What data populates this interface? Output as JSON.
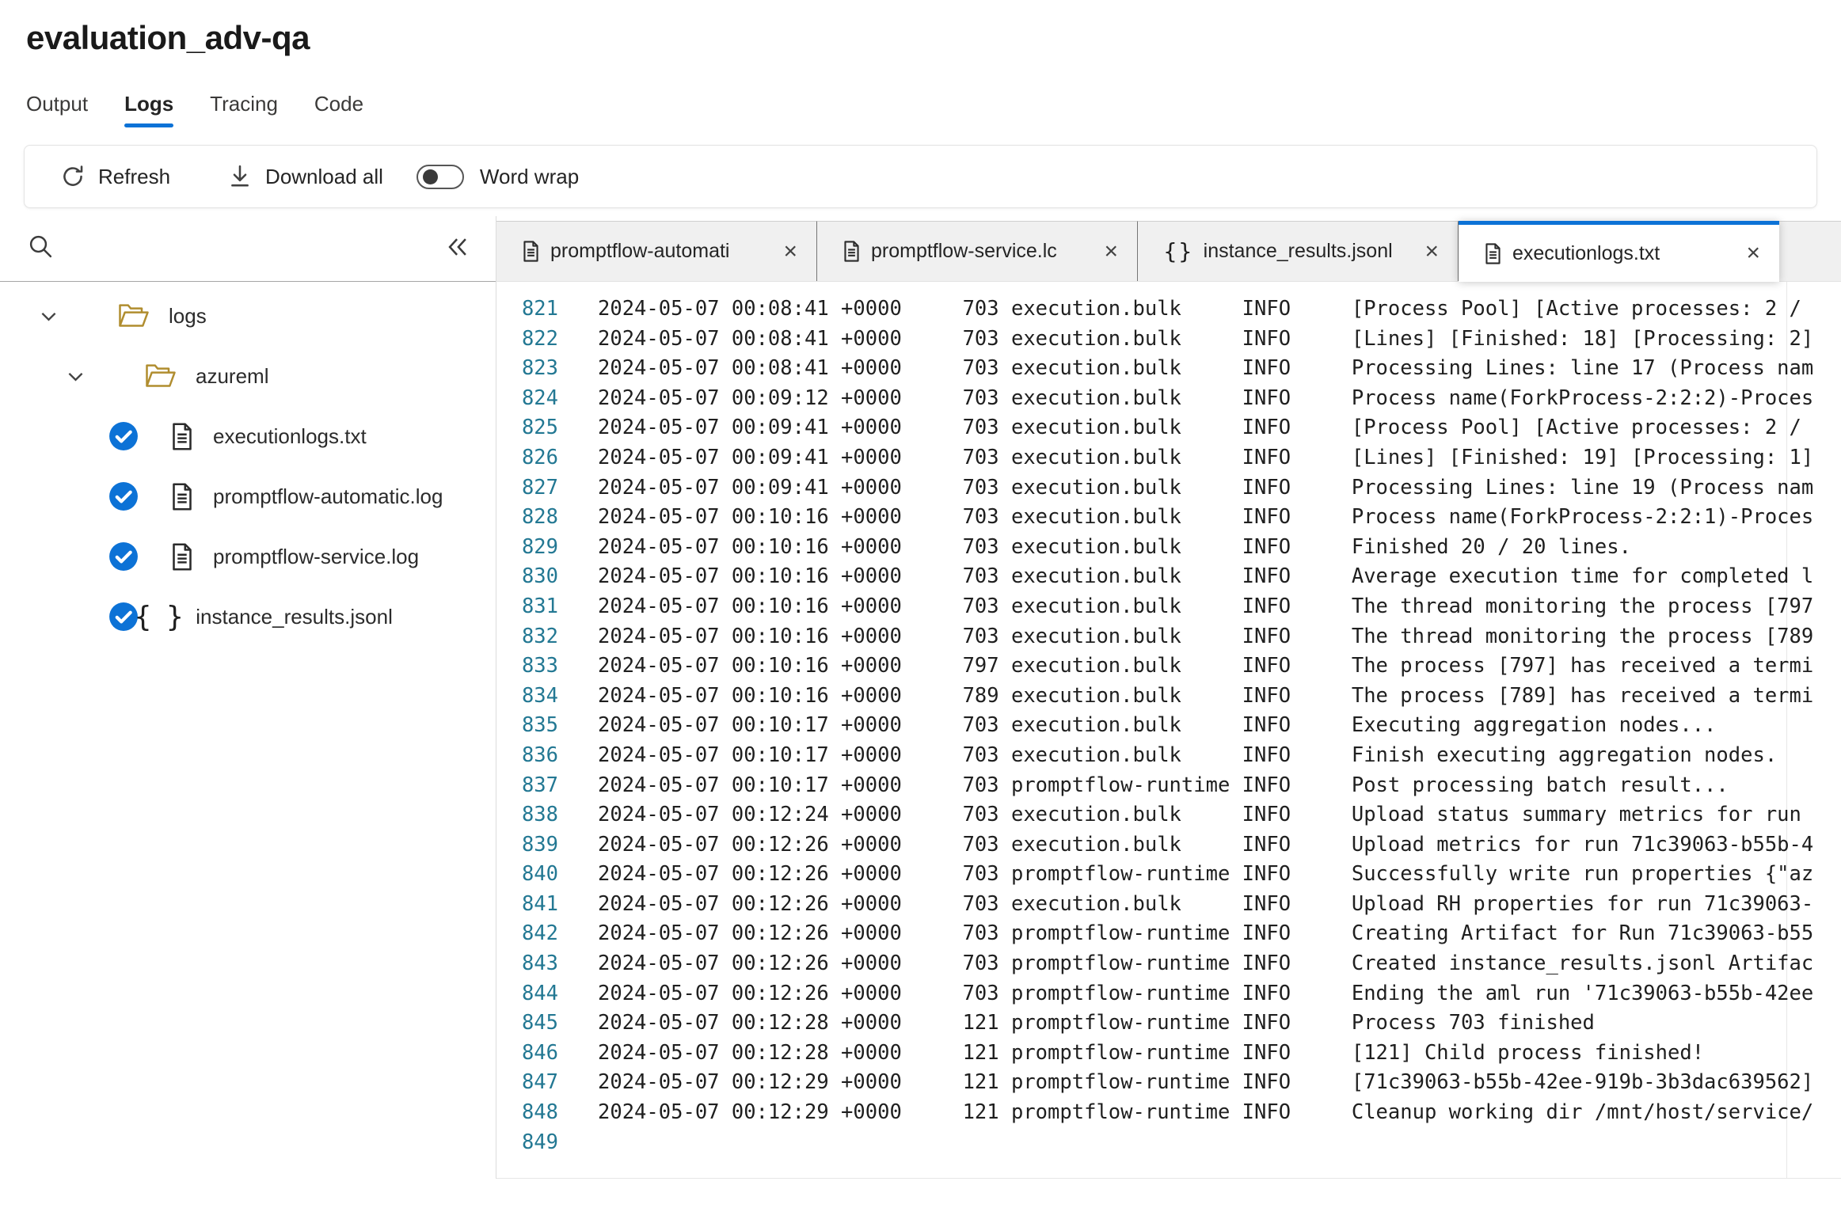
{
  "page": {
    "title": "evaluation_adv-qa"
  },
  "nav": {
    "tabs": [
      {
        "label": "Output",
        "active": false
      },
      {
        "label": "Logs",
        "active": true
      },
      {
        "label": "Tracing",
        "active": false
      },
      {
        "label": "Code",
        "active": false
      }
    ]
  },
  "toolbar": {
    "refresh_label": "Refresh",
    "download_label": "Download all",
    "wordwrap_label": "Word wrap",
    "wordwrap_on": false
  },
  "sidebar": {
    "tree": [
      {
        "label": "logs",
        "type": "folder",
        "level": 0,
        "expanded": true
      },
      {
        "label": "azureml",
        "type": "folder",
        "level": 1,
        "expanded": true
      },
      {
        "label": "executionlogs.txt",
        "type": "file",
        "level": 2,
        "checked": true
      },
      {
        "label": "promptflow-automatic.log",
        "type": "file",
        "level": 2,
        "checked": true
      },
      {
        "label": "promptflow-service.log",
        "type": "file",
        "level": 2,
        "checked": true
      },
      {
        "label": "instance_results.jsonl",
        "type": "json",
        "level": 2,
        "checked": true
      }
    ]
  },
  "file_tabs": [
    {
      "label": "promptflow-automati",
      "icon": "file",
      "active": false
    },
    {
      "label": "promptflow-service.lc",
      "icon": "file",
      "active": false
    },
    {
      "label": "instance_results.jsonl",
      "icon": "braces",
      "active": false
    },
    {
      "label": "executionlogs.txt",
      "icon": "file",
      "active": true
    }
  ],
  "log": {
    "lines": [
      {
        "no": 821,
        "ts": "2024-05-07 00:08:41 +0000",
        "pid": "703",
        "logger": "execution.bulk",
        "level": "INFO",
        "msg": "[Process Pool] [Active processes: 2 /"
      },
      {
        "no": 822,
        "ts": "2024-05-07 00:08:41 +0000",
        "pid": "703",
        "logger": "execution.bulk",
        "level": "INFO",
        "msg": "[Lines] [Finished: 18] [Processing: 2]"
      },
      {
        "no": 823,
        "ts": "2024-05-07 00:08:41 +0000",
        "pid": "703",
        "logger": "execution.bulk",
        "level": "INFO",
        "msg": "Processing Lines: line 17 (Process nam"
      },
      {
        "no": 824,
        "ts": "2024-05-07 00:09:12 +0000",
        "pid": "703",
        "logger": "execution.bulk",
        "level": "INFO",
        "msg": "Process name(ForkProcess-2:2:2)-Proces"
      },
      {
        "no": 825,
        "ts": "2024-05-07 00:09:41 +0000",
        "pid": "703",
        "logger": "execution.bulk",
        "level": "INFO",
        "msg": "[Process Pool] [Active processes: 2 /"
      },
      {
        "no": 826,
        "ts": "2024-05-07 00:09:41 +0000",
        "pid": "703",
        "logger": "execution.bulk",
        "level": "INFO",
        "msg": "[Lines] [Finished: 19] [Processing: 1]"
      },
      {
        "no": 827,
        "ts": "2024-05-07 00:09:41 +0000",
        "pid": "703",
        "logger": "execution.bulk",
        "level": "INFO",
        "msg": "Processing Lines: line 19 (Process nam"
      },
      {
        "no": 828,
        "ts": "2024-05-07 00:10:16 +0000",
        "pid": "703",
        "logger": "execution.bulk",
        "level": "INFO",
        "msg": "Process name(ForkProcess-2:2:1)-Proces"
      },
      {
        "no": 829,
        "ts": "2024-05-07 00:10:16 +0000",
        "pid": "703",
        "logger": "execution.bulk",
        "level": "INFO",
        "msg": "Finished 20 / 20 lines."
      },
      {
        "no": 830,
        "ts": "2024-05-07 00:10:16 +0000",
        "pid": "703",
        "logger": "execution.bulk",
        "level": "INFO",
        "msg": "Average execution time for completed l"
      },
      {
        "no": 831,
        "ts": "2024-05-07 00:10:16 +0000",
        "pid": "703",
        "logger": "execution.bulk",
        "level": "INFO",
        "msg": "The thread monitoring the process [797"
      },
      {
        "no": 832,
        "ts": "2024-05-07 00:10:16 +0000",
        "pid": "703",
        "logger": "execution.bulk",
        "level": "INFO",
        "msg": "The thread monitoring the process [789"
      },
      {
        "no": 833,
        "ts": "2024-05-07 00:10:16 +0000",
        "pid": "797",
        "logger": "execution.bulk",
        "level": "INFO",
        "msg": "The process [797] has received a termi"
      },
      {
        "no": 834,
        "ts": "2024-05-07 00:10:16 +0000",
        "pid": "789",
        "logger": "execution.bulk",
        "level": "INFO",
        "msg": "The process [789] has received a termi"
      },
      {
        "no": 835,
        "ts": "2024-05-07 00:10:17 +0000",
        "pid": "703",
        "logger": "execution.bulk",
        "level": "INFO",
        "msg": "Executing aggregation nodes..."
      },
      {
        "no": 836,
        "ts": "2024-05-07 00:10:17 +0000",
        "pid": "703",
        "logger": "execution.bulk",
        "level": "INFO",
        "msg": "Finish executing aggregation nodes."
      },
      {
        "no": 837,
        "ts": "2024-05-07 00:10:17 +0000",
        "pid": "703",
        "logger": "promptflow-runtime",
        "level": "INFO",
        "msg": "Post processing batch result..."
      },
      {
        "no": 838,
        "ts": "2024-05-07 00:12:24 +0000",
        "pid": "703",
        "logger": "execution.bulk",
        "level": "INFO",
        "msg": "Upload status summary metrics for run"
      },
      {
        "no": 839,
        "ts": "2024-05-07 00:12:26 +0000",
        "pid": "703",
        "logger": "execution.bulk",
        "level": "INFO",
        "msg": "Upload metrics for run 71c39063-b55b-4"
      },
      {
        "no": 840,
        "ts": "2024-05-07 00:12:26 +0000",
        "pid": "703",
        "logger": "promptflow-runtime",
        "level": "INFO",
        "msg": "Successfully write run properties {\"az"
      },
      {
        "no": 841,
        "ts": "2024-05-07 00:12:26 +0000",
        "pid": "703",
        "logger": "execution.bulk",
        "level": "INFO",
        "msg": "Upload RH properties for run 71c39063-"
      },
      {
        "no": 842,
        "ts": "2024-05-07 00:12:26 +0000",
        "pid": "703",
        "logger": "promptflow-runtime",
        "level": "INFO",
        "msg": "Creating Artifact for Run 71c39063-b55"
      },
      {
        "no": 843,
        "ts": "2024-05-07 00:12:26 +0000",
        "pid": "703",
        "logger": "promptflow-runtime",
        "level": "INFO",
        "msg": "Created instance_results.jsonl Artifac"
      },
      {
        "no": 844,
        "ts": "2024-05-07 00:12:26 +0000",
        "pid": "703",
        "logger": "promptflow-runtime",
        "level": "INFO",
        "msg": "Ending the aml run '71c39063-b55b-42ee"
      },
      {
        "no": 845,
        "ts": "2024-05-07 00:12:28 +0000",
        "pid": "121",
        "logger": "promptflow-runtime",
        "level": "INFO",
        "msg": "Process 703 finished"
      },
      {
        "no": 846,
        "ts": "2024-05-07 00:12:28 +0000",
        "pid": "121",
        "logger": "promptflow-runtime",
        "level": "INFO",
        "msg": "[121] Child process finished!"
      },
      {
        "no": 847,
        "ts": "2024-05-07 00:12:29 +0000",
        "pid": "121",
        "logger": "promptflow-runtime",
        "level": "INFO",
        "msg": "[71c39063-b55b-42ee-919b-3b3dac639562]"
      },
      {
        "no": 848,
        "ts": "2024-05-07 00:12:29 +0000",
        "pid": "121",
        "logger": "promptflow-runtime",
        "level": "INFO",
        "msg": "Cleanup working dir /mnt/host/service/"
      },
      {
        "no": 849
      }
    ]
  },
  "colors": {
    "accent": "#0c72d6",
    "line_number": "#237893",
    "folder_icon": "#b08d2f",
    "log_text": "#1f1f1f"
  }
}
